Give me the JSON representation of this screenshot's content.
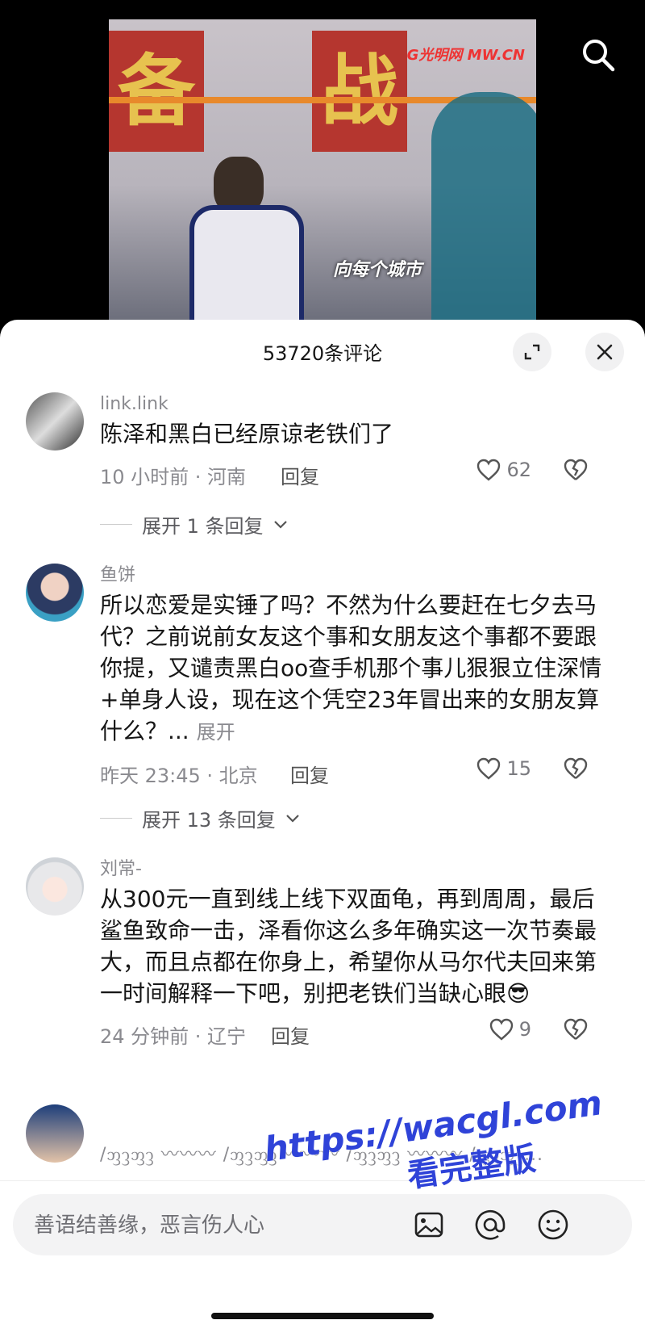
{
  "video": {
    "banner_left": "备",
    "banner_right": "战",
    "logo": "G光明网 MW.CN",
    "caption": "向每个城市"
  },
  "sheet": {
    "title": "53720条评论",
    "expand_icon": "fullscreen-icon",
    "close_icon": "close-icon"
  },
  "comments": [
    {
      "user": "link.link",
      "text": "陈泽和黑白已经原谅老铁们了",
      "time_location": "10 小时前 · 河南",
      "reply": "回复",
      "likes": "62",
      "expand": "展开 1 条回复"
    },
    {
      "user": "鱼饼",
      "text": "所以恋爱是实锤了吗？不然为什么要赶在七夕去马代？之前说前女友这个事和女朋友这个事都不要跟你提，又谴责黑白oo查手机那个事儿狠狠立住深情+单身人设，现在这个凭空23年冒出来的女朋友算什么？...",
      "more": "展开",
      "time_location": "昨天 23:45 · 北京",
      "reply": "回复",
      "likes": "15",
      "expand": "展开 13 条回复"
    },
    {
      "user": "刘常-",
      "text": "从300元一直到线上线下双面龟，再到周周，最后鲨鱼致命一击，泽看你这么多年确实这一次节奏最大，而且点都在你身上，希望你从马尔代夫回来第一时间解释一下吧，别把老铁们当缺心眼😎",
      "time_location": "24 分钟前 · 辽宁",
      "reply": "回复",
      "likes": "9"
    }
  ],
  "partial_comment": "/ᦀᦡᦀᦡ 〰〰〰 /ᦀᦡᦀᦡ 〰〰〰 /ᦀᦡᦀᦡ 〰〰〰 /ᦀᦡᦀᦡ...",
  "input": {
    "placeholder": "善语结善缘，恶言伤人心"
  },
  "watermark": {
    "url": "https://wacgl.com",
    "sub": "看完整版"
  },
  "colors": {
    "accent_watermark": "#2f43d8",
    "banner_red": "#b5362f"
  }
}
